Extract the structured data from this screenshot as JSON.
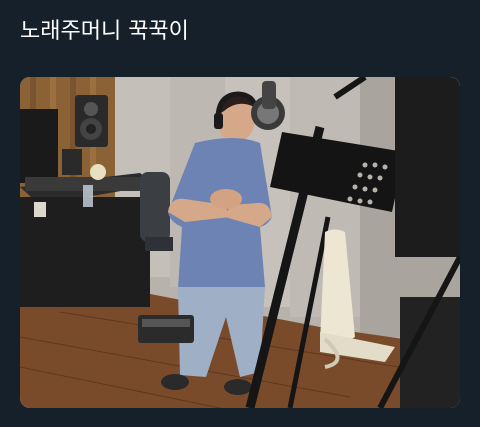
{
  "post": {
    "text": "노래주머니 꾹꾹이"
  },
  "media": {
    "type": "photo"
  },
  "colors": {
    "background": "#15202b",
    "text": "#ffffff"
  }
}
